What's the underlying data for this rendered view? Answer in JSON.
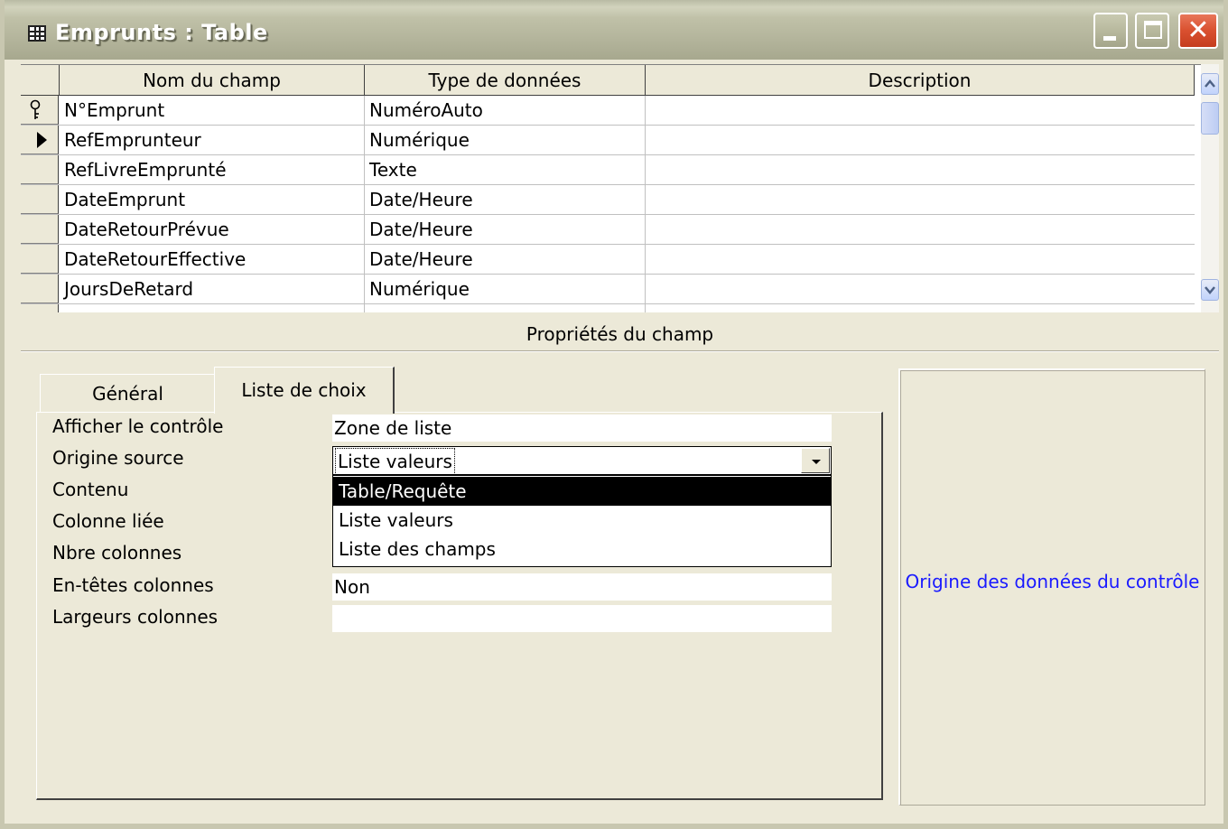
{
  "window": {
    "title": "Emprunts : Table",
    "colors": {
      "titlebar": "#b9bba4",
      "close": "#d9502f",
      "accent_text": "#1a1aff"
    }
  },
  "grid": {
    "columns": [
      "Nom du champ",
      "Type de données",
      "Description"
    ],
    "rows": [
      {
        "name": "N°Emprunt",
        "type": "NuméroAuto",
        "description": "",
        "indicator": "key-icon"
      },
      {
        "name": "RefEmprunteur",
        "type": "Numérique",
        "description": "",
        "indicator": "current-row-arrow-icon"
      },
      {
        "name": "RefLivreEmprunté",
        "type": "Texte",
        "description": ""
      },
      {
        "name": "DateEmprunt",
        "type": "Date/Heure",
        "description": ""
      },
      {
        "name": "DateRetourPrévue",
        "type": "Date/Heure",
        "description": ""
      },
      {
        "name": "DateRetourEffective",
        "type": "Date/Heure",
        "description": ""
      },
      {
        "name": "JoursDeRetard",
        "type": "Numérique",
        "description": ""
      }
    ]
  },
  "properties": {
    "title": "Propriétés du champ",
    "tabs": [
      "Général",
      "Liste de choix"
    ],
    "active_tab": "Liste de choix",
    "fields": [
      {
        "label": "Afficher le contrôle",
        "value": "Zone de liste"
      },
      {
        "label": "Origine source",
        "value": "Liste valeurs"
      },
      {
        "label": "Contenu",
        "value": ""
      },
      {
        "label": "Colonne liée",
        "value": ""
      },
      {
        "label": "Nbre colonnes",
        "value": ""
      },
      {
        "label": "En-têtes colonnes",
        "value": "Non"
      },
      {
        "label": "Largeurs colonnes",
        "value": ""
      }
    ],
    "dropdown_options": [
      "Table/Requête",
      "Liste valeurs",
      "Liste des champs"
    ],
    "highlighted_option": "Table/Requête",
    "help_text": "Origine des données du contrôle"
  }
}
